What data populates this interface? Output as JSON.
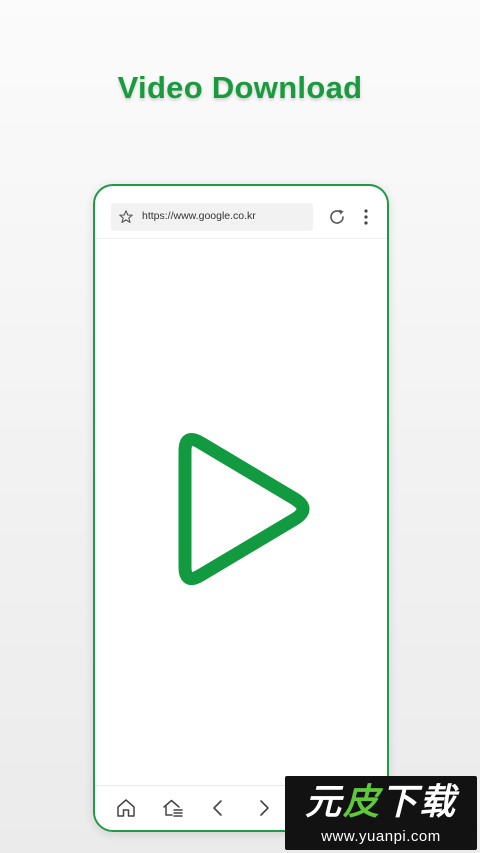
{
  "headline": "Video Download",
  "browser": {
    "url": "https://www.google.co.kr",
    "icons": {
      "bookmark": "star-icon",
      "reload": "refresh-icon",
      "menu": "more-vertical-icon"
    }
  },
  "content": {
    "logo_icon": "play-triangle-icon"
  },
  "bottom_nav": {
    "items": [
      {
        "icon": "home-icon"
      },
      {
        "icon": "home-list-icon"
      },
      {
        "icon": "chevron-left-icon"
      },
      {
        "icon": "chevron-right-icon"
      }
    ]
  },
  "watermark": {
    "title_part1": "元",
    "title_part2": "皮",
    "title_part3": "下载",
    "url": "www.yuanpi.com"
  },
  "colors": {
    "brand_green": "#1a9a3e",
    "frame_green": "#1f9a45",
    "play_green": "#129a40",
    "watermark_green": "#5fc93a",
    "watermark_bg": "#121212"
  }
}
